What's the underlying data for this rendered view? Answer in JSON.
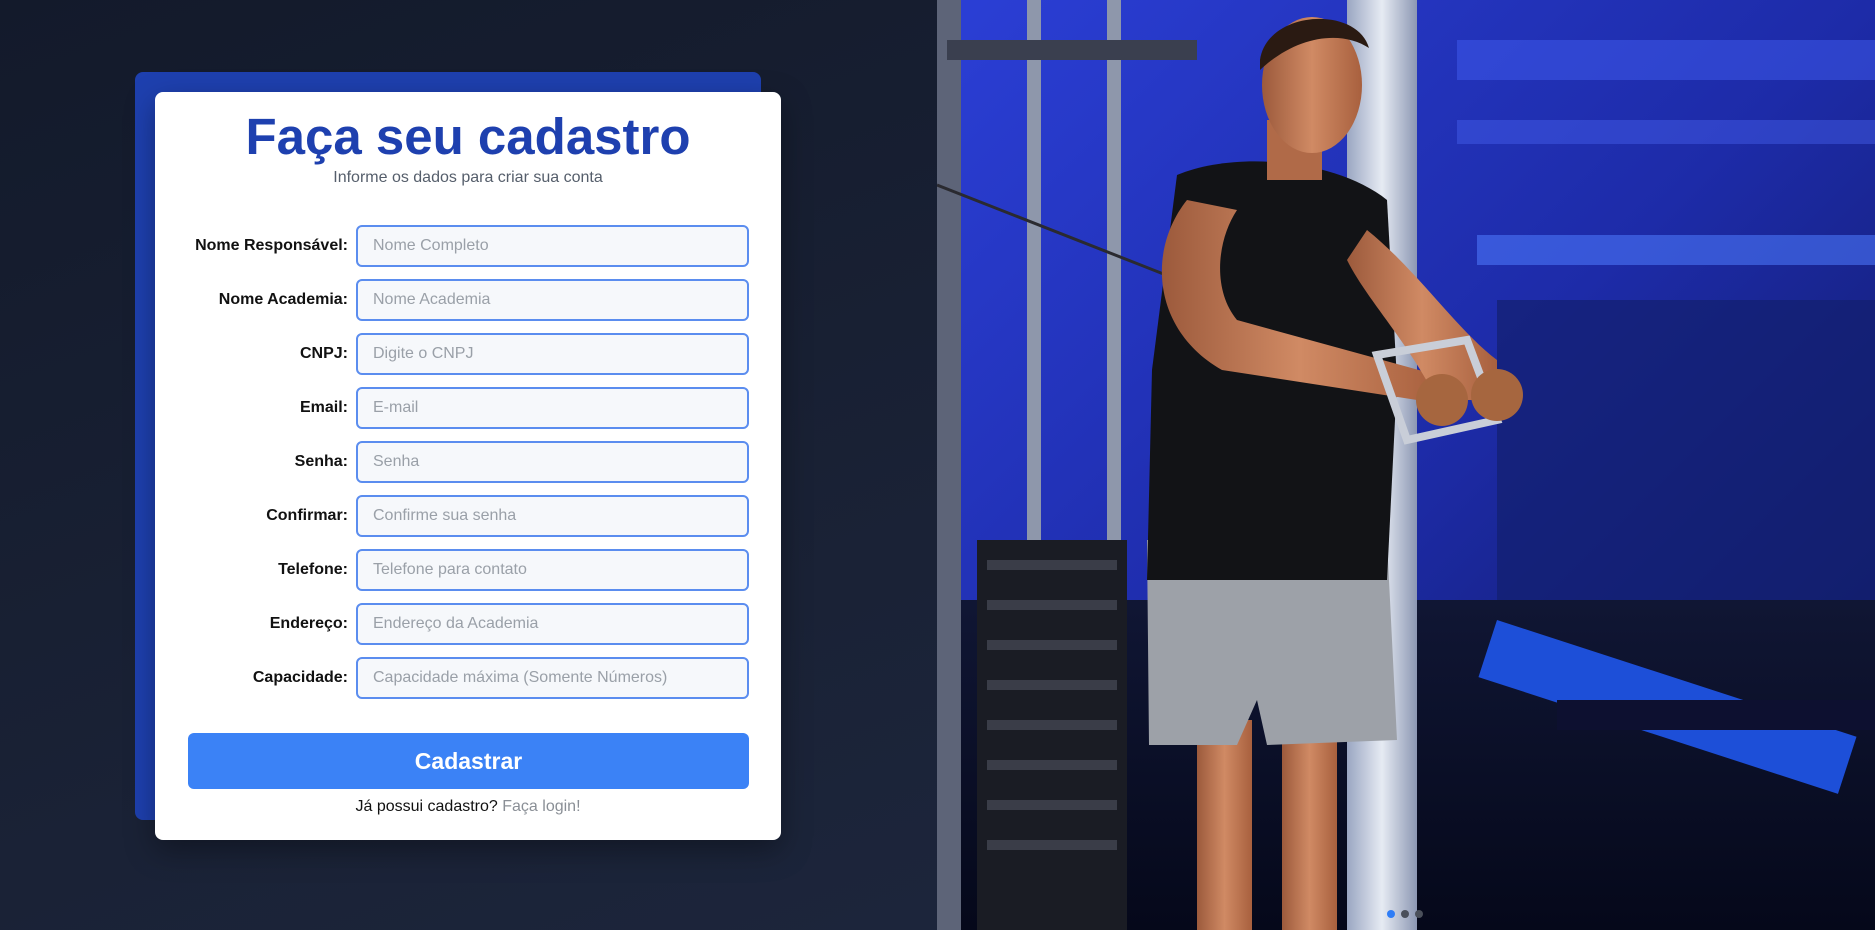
{
  "form": {
    "title": "Faça seu cadastro",
    "subtitle": "Informe os dados para criar sua conta",
    "fields": [
      {
        "label": "Nome Responsável:",
        "placeholder": "Nome Completo"
      },
      {
        "label": "Nome Academia:",
        "placeholder": "Nome Academia"
      },
      {
        "label": "CNPJ:",
        "placeholder": "Digite o CNPJ"
      },
      {
        "label": "Email:",
        "placeholder": "E-mail"
      },
      {
        "label": "Senha:",
        "placeholder": "Senha"
      },
      {
        "label": "Confirmar:",
        "placeholder": "Confirme sua senha"
      },
      {
        "label": "Telefone:",
        "placeholder": "Telefone para contato"
      },
      {
        "label": "Endereço:",
        "placeholder": "Endereço da Academia"
      },
      {
        "label": "Capacidade:",
        "placeholder": "Capacidade máxima (Somente Números)"
      }
    ],
    "submit_label": "Cadastrar",
    "login_prompt": "Já possui cadastro?",
    "login_link": "Faça login!"
  },
  "carousel": {
    "image_icon": "gym-photo-man-cable-crossover",
    "slide_count": 3,
    "active_index": 0
  },
  "colors": {
    "accent": "#3b82f6",
    "title": "#1e40af",
    "input_border": "#5b8def",
    "background": "#151c2e"
  }
}
